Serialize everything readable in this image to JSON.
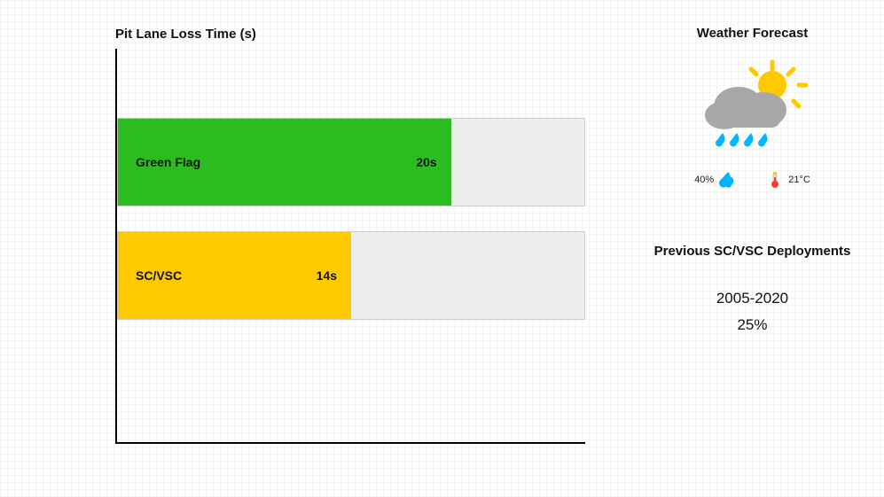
{
  "chart_data": {
    "type": "bar",
    "title": "Pit Lane Loss Time (s)",
    "unit": "s",
    "max_value": 28,
    "categories": [
      "Green Flag",
      "SC/VSC"
    ],
    "values": [
      20,
      14
    ],
    "colors": [
      "#2bbd1d",
      "#ffc900"
    ]
  },
  "chart": {
    "title": "Pit Lane Loss Time (s)",
    "bars": [
      {
        "label": "Green Flag",
        "value": 20,
        "display": "20s"
      },
      {
        "label": "SC/VSC",
        "value": 14,
        "display": "14s"
      }
    ]
  },
  "weather": {
    "title": "Weather Forecast",
    "rain_chance": "40%",
    "temperature": "21°C"
  },
  "deployments": {
    "title": "Previous SC/VSC Deployments",
    "years": "2005-2020",
    "percent": "25%"
  }
}
